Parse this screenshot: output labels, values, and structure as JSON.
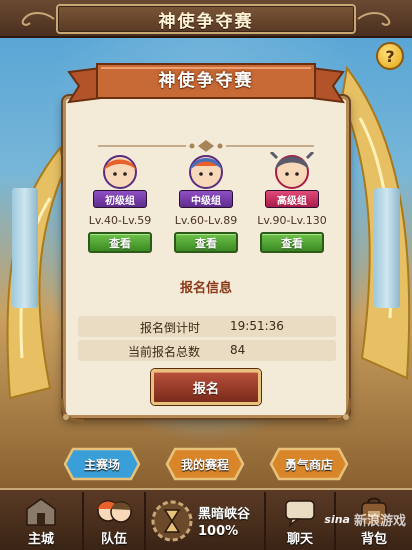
{
  "header": {
    "title": "神使争夺赛"
  },
  "panel": {
    "banner_title": "神使争夺赛",
    "groups": [
      {
        "badge": "初级组",
        "level": "Lv.40-Lv.59",
        "button": "查看"
      },
      {
        "badge": "中级组",
        "level": "Lv.60-Lv.89",
        "button": "查看"
      },
      {
        "badge": "高级组",
        "level": "Lv.90-Lv.130",
        "button": "查看"
      }
    ],
    "signup_info": {
      "title": "报名信息",
      "rows": [
        {
          "label": "报名倒计时",
          "value": "19:51:36"
        },
        {
          "label": "当前报名总数",
          "value": "84"
        }
      ]
    },
    "signup_button": "报名"
  },
  "help": {
    "icon": "question-icon",
    "glyph": "?"
  },
  "tabs": [
    {
      "label": "主赛场",
      "color": "#3a9fd8"
    },
    {
      "label": "我的赛程",
      "color": "#e89a3a"
    },
    {
      "label": "勇气商店",
      "color": "#e89a3a"
    }
  ],
  "bottom_nav": {
    "city": "主城",
    "team": "队伍",
    "canyon_name": "黑暗峡谷",
    "canyon_percent": "100%",
    "chat": "聊天",
    "bag": "背包"
  },
  "watermark": {
    "logo": "sina",
    "text": "新浪游戏"
  }
}
